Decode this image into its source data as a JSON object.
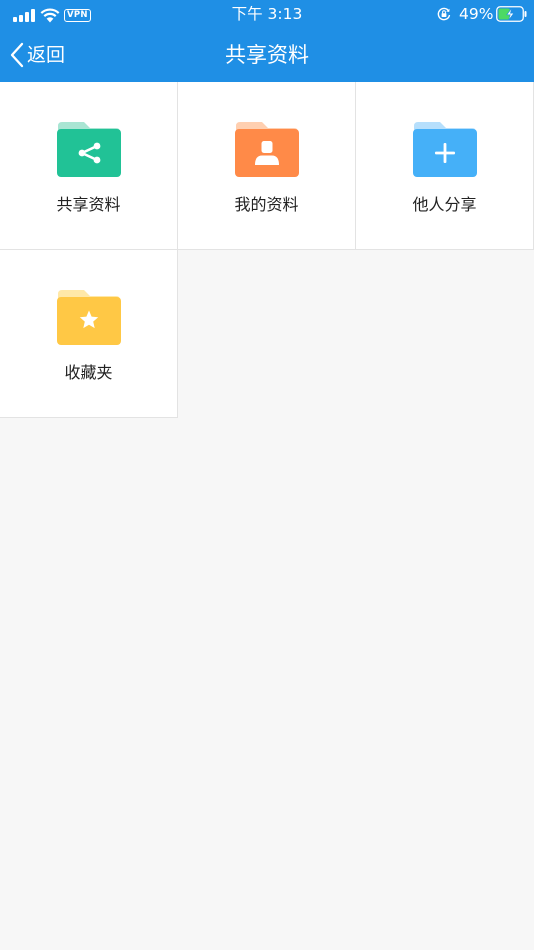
{
  "colors": {
    "header": "#1f8fe5",
    "background": "#f7f7f7",
    "tile": "#ffffff",
    "divider": "#e3e3e3",
    "label_text": "#222222",
    "battery_charge": "#4cd964"
  },
  "status_bar": {
    "vpn_label": "VPN",
    "time": "下午 3:13",
    "battery_percent": "49%",
    "battery_level": 0.49,
    "charging": true
  },
  "nav": {
    "back_label": "返回",
    "title": "共享资料"
  },
  "tiles": [
    {
      "label": "共享资料",
      "icon": "share-folder-icon",
      "color": "#21c296",
      "tab_color": "#a9e5d3"
    },
    {
      "label": "我的资料",
      "icon": "user-folder-icon",
      "color": "#ff8a48",
      "tab_color": "#ffcfb0"
    },
    {
      "label": "他人分享",
      "icon": "add-folder-icon",
      "color": "#45b0f8",
      "tab_color": "#b6dffc"
    },
    {
      "label": "收藏夹",
      "icon": "star-folder-icon",
      "color": "#ffc845",
      "tab_color": "#ffe8a8"
    }
  ]
}
